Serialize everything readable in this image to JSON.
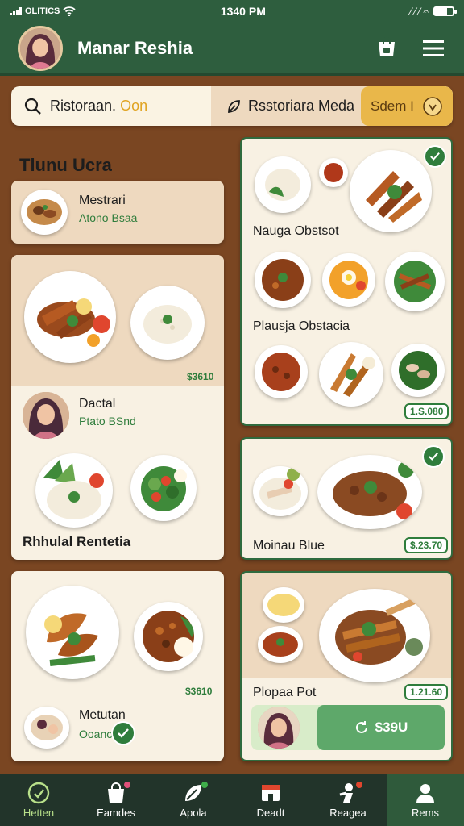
{
  "status_bar": {
    "carrier": "OLITICS",
    "time": "1340 PM",
    "icons_right": "⁄ ⁄  ⁄ 𝄐"
  },
  "app_bar": {
    "title": "Manar Reshia"
  },
  "search": {
    "left_text": "Ristoraan.",
    "left_accent": "Oon",
    "right_text": "Rsstoriara Meda",
    "pill_text": "Sdem I"
  },
  "section": {
    "title": "Tlunu Ucra"
  },
  "left_cards": [
    {
      "title": "Mestrari",
      "subtitle": "Atono Bsaa"
    },
    {
      "price": "$3610",
      "title": "Dactal",
      "subtitle": "Ptato BSnd",
      "footer": "Rhhulal Rentetia"
    },
    {
      "price": "$3610",
      "title": "Metutan",
      "subtitle": "Ooano"
    }
  ],
  "right_cards": [
    {
      "label1": "Nauga Obstsot",
      "label2": "Plausja Obstacia",
      "price": "1.S.080"
    },
    {
      "label": "Moinau Blue",
      "price": "$.23.70"
    },
    {
      "label": "Plopaa Pot",
      "price": "1.21.60",
      "action": "$39U"
    }
  ],
  "tabbar": {
    "items": [
      {
        "label": "Hetten"
      },
      {
        "label": "Eamdes"
      },
      {
        "label": "Apola"
      },
      {
        "label": "Deadt"
      },
      {
        "label": "Reagea"
      },
      {
        "label": "Rems"
      }
    ]
  },
  "colors": {
    "primary": "#2e5e3e",
    "background": "#7a4622",
    "card": "#f8f1e3",
    "accent": "#e9b74a",
    "price_green": "#2f7d3c"
  },
  "icons": [
    "signal-icon",
    "wifi-icon",
    "battery-icon",
    "store-icon",
    "menu-icon",
    "search-icon",
    "leaf-icon",
    "location-pin-icon",
    "check-icon",
    "home-icon",
    "bag-icon",
    "leaf-tab-icon",
    "shop-icon",
    "chef-icon",
    "profile-icon"
  ]
}
